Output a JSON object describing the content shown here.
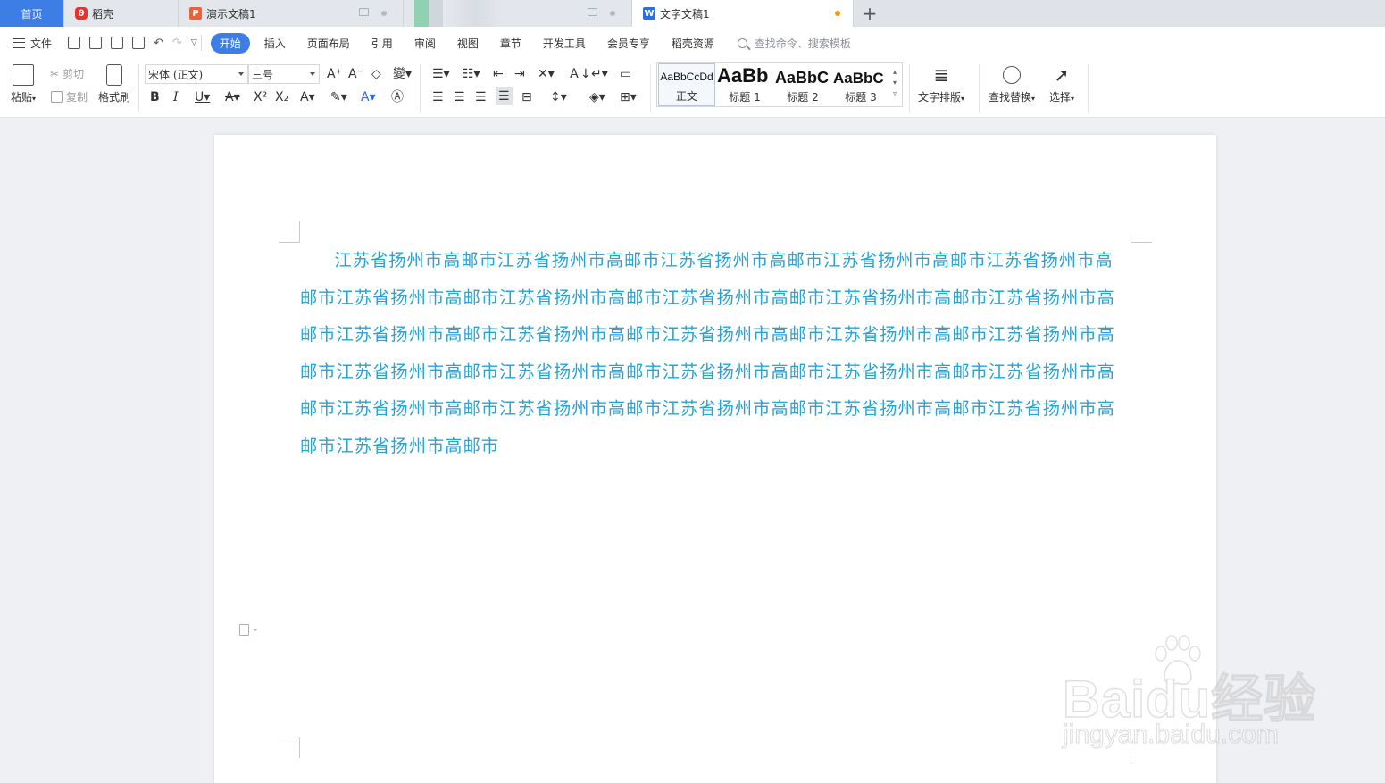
{
  "tabs": [
    {
      "label": "首页",
      "active": false
    },
    {
      "label": "稻壳",
      "icon": "daoke-logo-icon"
    },
    {
      "label": "演示文稿1",
      "icon": "presentation-icon"
    },
    {
      "label": "",
      "icon": "blurred-tab"
    },
    {
      "label": "文字文稿1",
      "icon": "writer-icon",
      "unsaved": true
    }
  ],
  "new_tab": "+",
  "menu": {
    "file_label": "文件",
    "tabs": [
      "开始",
      "插入",
      "页面布局",
      "引用",
      "审阅",
      "视图",
      "章节",
      "开发工具",
      "会员专享",
      "稻壳资源"
    ],
    "active_tab": "开始",
    "search_placeholder": "查找命令、搜索模板"
  },
  "ribbon": {
    "paste": "粘贴",
    "cut": "剪切",
    "copy": "复制",
    "format_painter": "格式刷",
    "font_name": "宋体 (正文)",
    "font_size": "三号",
    "styles": [
      {
        "sample": "AaBbCcDd",
        "name": "正文"
      },
      {
        "sample": "AaBb",
        "name": "标题 1"
      },
      {
        "sample": "AaBbC",
        "name": "标题 2"
      },
      {
        "sample": "AaBbC",
        "name": "标题 3"
      }
    ],
    "text_layout": "文字排版",
    "find_replace": "查找替换",
    "select": "选择"
  },
  "document": {
    "paragraph": "江苏省扬州市高邮市江苏省扬州市高邮市江苏省扬州市高邮市江苏省扬州市高邮市江苏省扬州市高邮市江苏省扬州市高邮市江苏省扬州市高邮市江苏省扬州市高邮市江苏省扬州市高邮市江苏省扬州市高邮市江苏省扬州市高邮市江苏省扬州市高邮市江苏省扬州市高邮市江苏省扬州市高邮市江苏省扬州市高邮市江苏省扬州市高邮市江苏省扬州市高邮市江苏省扬州市高邮市江苏省扬州市高邮市江苏省扬州市高邮市江苏省扬州市高邮市江苏省扬州市高邮市江苏省扬州市高邮市江苏省扬州市高邮市江苏省扬州市高邮市江苏省扬州市高邮市",
    "text_color": "#27a3d6"
  },
  "watermark": {
    "logo": "Baidu经验",
    "url": "jingyan.baidu.com"
  }
}
